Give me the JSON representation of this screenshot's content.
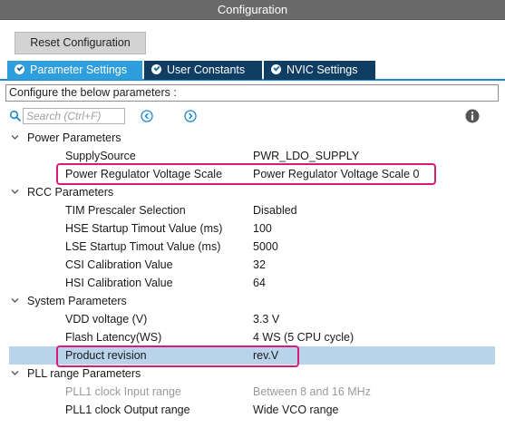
{
  "window": {
    "title": "Configuration"
  },
  "toolbar": {
    "reset_label": "Reset Configuration"
  },
  "tabs": [
    {
      "label": "Parameter Settings",
      "active": true
    },
    {
      "label": "User Constants",
      "active": false
    },
    {
      "label": "NVIC Settings",
      "active": false
    }
  ],
  "configure_text": "Configure the below parameters :",
  "search": {
    "placeholder": "Search (Ctrl+F)",
    "value": ""
  },
  "icons": {
    "search": "search-icon",
    "prev": "chevron-left-circle-icon",
    "next": "chevron-right-circle-icon",
    "info": "info-icon",
    "expand": "chevron-down-icon",
    "tab_check": "check-circle-icon"
  },
  "colors": {
    "titlebar": "#6a6a6a",
    "active_tab": "#2e9fdc",
    "inactive_tab": "#0f3d63",
    "highlight": "#d81b79",
    "selected_row": "#b9d3ea",
    "accent": "#1e88c8"
  },
  "groups": [
    {
      "label": "Power Parameters",
      "params": [
        {
          "name": "SupplySource",
          "value": "PWR_LDO_SUPPLY"
        },
        {
          "name": "Power Regulator Voltage Scale",
          "value": "Power Regulator Voltage Scale 0",
          "highlighted": true
        }
      ]
    },
    {
      "label": "RCC Parameters",
      "params": [
        {
          "name": "TIM Prescaler Selection",
          "value": "Disabled"
        },
        {
          "name": "HSE Startup Timout Value (ms)",
          "value": "100"
        },
        {
          "name": "LSE Startup Timout Value (ms)",
          "value": "5000"
        },
        {
          "name": "CSI Calibration Value",
          "value": "32"
        },
        {
          "name": "HSI Calibration Value",
          "value": "64"
        }
      ]
    },
    {
      "label": "System Parameters",
      "params": [
        {
          "name": "VDD voltage (V)",
          "value": "3.3 V"
        },
        {
          "name": "Flash Latency(WS)",
          "value": "4 WS (5 CPU cycle)"
        },
        {
          "name": "Product revision",
          "value": "rev.V",
          "highlighted": true,
          "selected": true
        }
      ]
    },
    {
      "label": "PLL range Parameters",
      "params": [
        {
          "name": "PLL1 clock Input range",
          "value": "Between 8 and 16 MHz",
          "disabled": true
        },
        {
          "name": "PLL1 clock Output range",
          "value": "Wide VCO range"
        }
      ]
    }
  ]
}
